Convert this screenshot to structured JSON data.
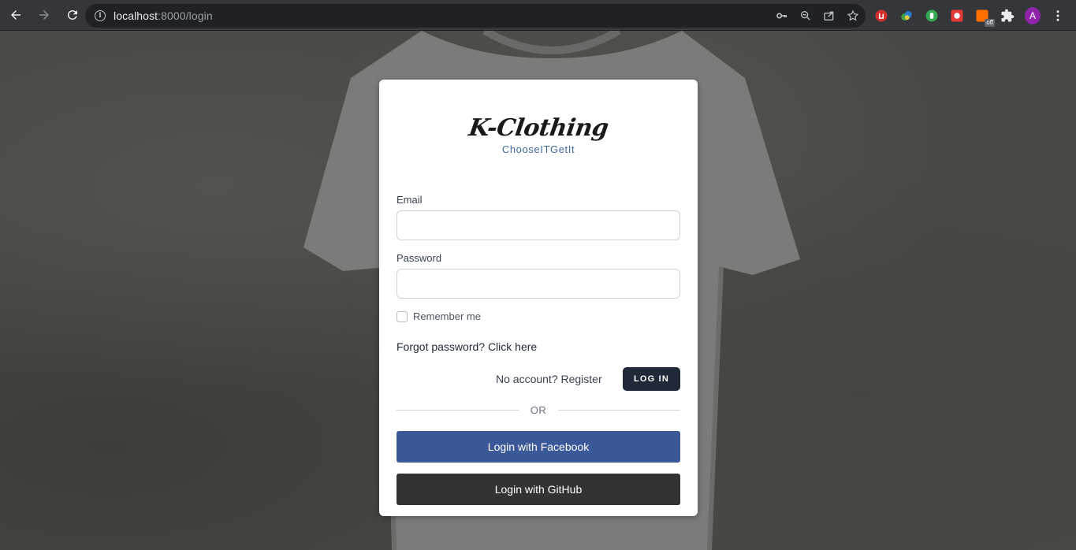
{
  "browser": {
    "url_host": "localhost",
    "url_rest": ":8000/login",
    "profile_initial": "A",
    "ext_badge": "off"
  },
  "login": {
    "logo_title": "K-Clothing",
    "logo_tagline": "ChooseITGetIt",
    "email_label": "Email",
    "email_value": "",
    "password_label": "Password",
    "password_value": "",
    "remember_label": "Remember me",
    "forgot_text": "Forgot password? Click here",
    "register_text": "No account? Register",
    "login_button": "LOG IN",
    "or_text": "OR",
    "facebook_button": "Login with Facebook",
    "github_button": "Login with GitHub"
  },
  "colors": {
    "facebook": "#3b5998",
    "github": "#333333",
    "primary_button": "#1f2937",
    "tagline": "#3f6aa0"
  }
}
